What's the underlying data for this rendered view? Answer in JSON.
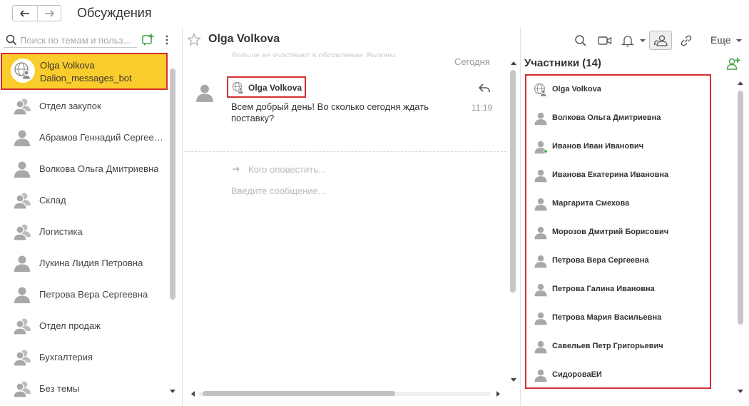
{
  "window": {
    "title": "Обсуждения"
  },
  "sidebar": {
    "search_placeholder": "Поиск по темам и польз...",
    "selected": {
      "name": "Olga Volkova",
      "subtitle": "Dalion_messages_bot",
      "icon": "globe-user-icon"
    },
    "items": [
      {
        "label": "Отдел закупок",
        "icon": "group-icon"
      },
      {
        "label": "Абрамов Геннадий Сергеевич",
        "icon": "user-icon"
      },
      {
        "label": "Волкова Ольга Дмитриевна",
        "icon": "user-icon"
      },
      {
        "label": "Склад",
        "icon": "group-icon"
      },
      {
        "label": "Логистика",
        "icon": "group-icon"
      },
      {
        "label": "Лукина Лидия Петровна",
        "icon": "user-icon"
      },
      {
        "label": "Петрова Вера Сергеевна",
        "icon": "user-icon"
      },
      {
        "label": "Отдел продаж",
        "icon": "group-icon"
      },
      {
        "label": "Бухгалтерия",
        "icon": "group-icon"
      },
      {
        "label": "Без темы",
        "icon": "group-icon"
      }
    ]
  },
  "chat": {
    "title": "Olga Volkova",
    "more_label": "Еще",
    "date_separator": "Сегодня",
    "faded_previous": "больше не участвуют в обсуждении. Вызовы",
    "message": {
      "author": "Olga Volkova",
      "text": "Всем добрый день! Во сколько сегодня ждать поставку?",
      "time": "11:19"
    },
    "notify_placeholder": "Кого оповестить...",
    "input_placeholder": "Введите сообщение..."
  },
  "members": {
    "title": "Участники (14)",
    "items": [
      {
        "name": "Olga Volkova",
        "icon": "globe-user-icon",
        "online": false
      },
      {
        "name": "Волкова Ольга Дмитриевна",
        "icon": "user-icon",
        "online": false
      },
      {
        "name": "Иванов Иван Иванович",
        "icon": "user-icon",
        "online": true
      },
      {
        "name": "Иванова Екатерина Ивановна",
        "icon": "user-icon",
        "online": false
      },
      {
        "name": "Маргарита Смехова",
        "icon": "user-icon",
        "online": false
      },
      {
        "name": "Морозов Дмитрий Борисович",
        "icon": "user-icon",
        "online": false
      },
      {
        "name": "Петрова Вера Сергеевна",
        "icon": "user-icon",
        "online": false
      },
      {
        "name": "Петрова Галина Ивановна",
        "icon": "user-icon",
        "online": false
      },
      {
        "name": "Петрова Мария Васильевна",
        "icon": "user-icon",
        "online": false
      },
      {
        "name": "Савельев Петр Григорьевич",
        "icon": "user-icon",
        "online": false
      },
      {
        "name": "СидороваЕИ",
        "icon": "user-icon",
        "online": false
      }
    ]
  },
  "colors": {
    "selected_bg": "#fbcd2c",
    "highlight_border": "#d32f2f",
    "accent_green": "#4caf50"
  }
}
